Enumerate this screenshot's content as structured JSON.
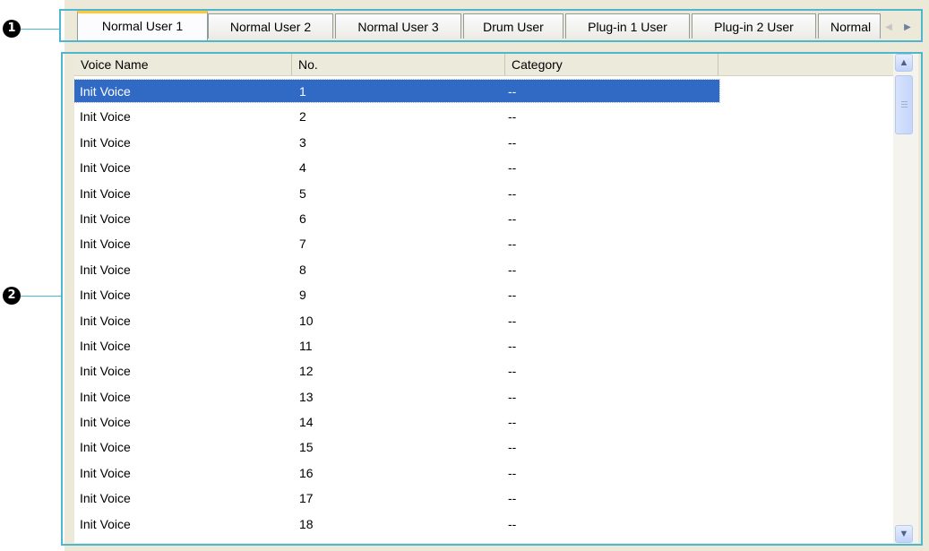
{
  "callouts": {
    "tabs": "1",
    "list": "2"
  },
  "tabs": [
    {
      "label": "Normal User 1",
      "active": true
    },
    {
      "label": "Normal User 2",
      "active": false
    },
    {
      "label": "Normal User 3",
      "active": false
    },
    {
      "label": "Drum User",
      "active": false
    },
    {
      "label": "Plug-in 1 User",
      "active": false
    },
    {
      "label": "Plug-in 2 User",
      "active": false
    },
    {
      "label": "Normal",
      "active": false
    }
  ],
  "columns": [
    "Voice Name",
    "No.",
    "Category"
  ],
  "rows": [
    {
      "name": "Init Voice",
      "no": "1",
      "category": "--",
      "selected": true
    },
    {
      "name": "Init Voice",
      "no": "2",
      "category": "--"
    },
    {
      "name": "Init Voice",
      "no": "3",
      "category": "--"
    },
    {
      "name": "Init Voice",
      "no": "4",
      "category": "--"
    },
    {
      "name": "Init Voice",
      "no": "5",
      "category": "--"
    },
    {
      "name": "Init Voice",
      "no": "6",
      "category": "--"
    },
    {
      "name": "Init Voice",
      "no": "7",
      "category": "--"
    },
    {
      "name": "Init Voice",
      "no": "8",
      "category": "--"
    },
    {
      "name": "Init Voice",
      "no": "9",
      "category": "--"
    },
    {
      "name": "Init Voice",
      "no": "10",
      "category": "--"
    },
    {
      "name": "Init Voice",
      "no": "11",
      "category": "--"
    },
    {
      "name": "Init Voice",
      "no": "12",
      "category": "--"
    },
    {
      "name": "Init Voice",
      "no": "13",
      "category": "--"
    },
    {
      "name": "Init Voice",
      "no": "14",
      "category": "--"
    },
    {
      "name": "Init Voice",
      "no": "15",
      "category": "--"
    },
    {
      "name": "Init Voice",
      "no": "16",
      "category": "--"
    },
    {
      "name": "Init Voice",
      "no": "17",
      "category": "--"
    },
    {
      "name": "Init Voice",
      "no": "18",
      "category": "--"
    }
  ],
  "icons": {
    "tab_scroll_left": "chevron-left-icon",
    "tab_scroll_right": "chevron-right-icon",
    "scroll_up": "chevron-up-icon",
    "scroll_down": "chevron-down-icon"
  },
  "colors": {
    "callout_line": "#4eb6cf",
    "selection": "#316ac5",
    "active_tab_accent": "#ffc83c"
  }
}
